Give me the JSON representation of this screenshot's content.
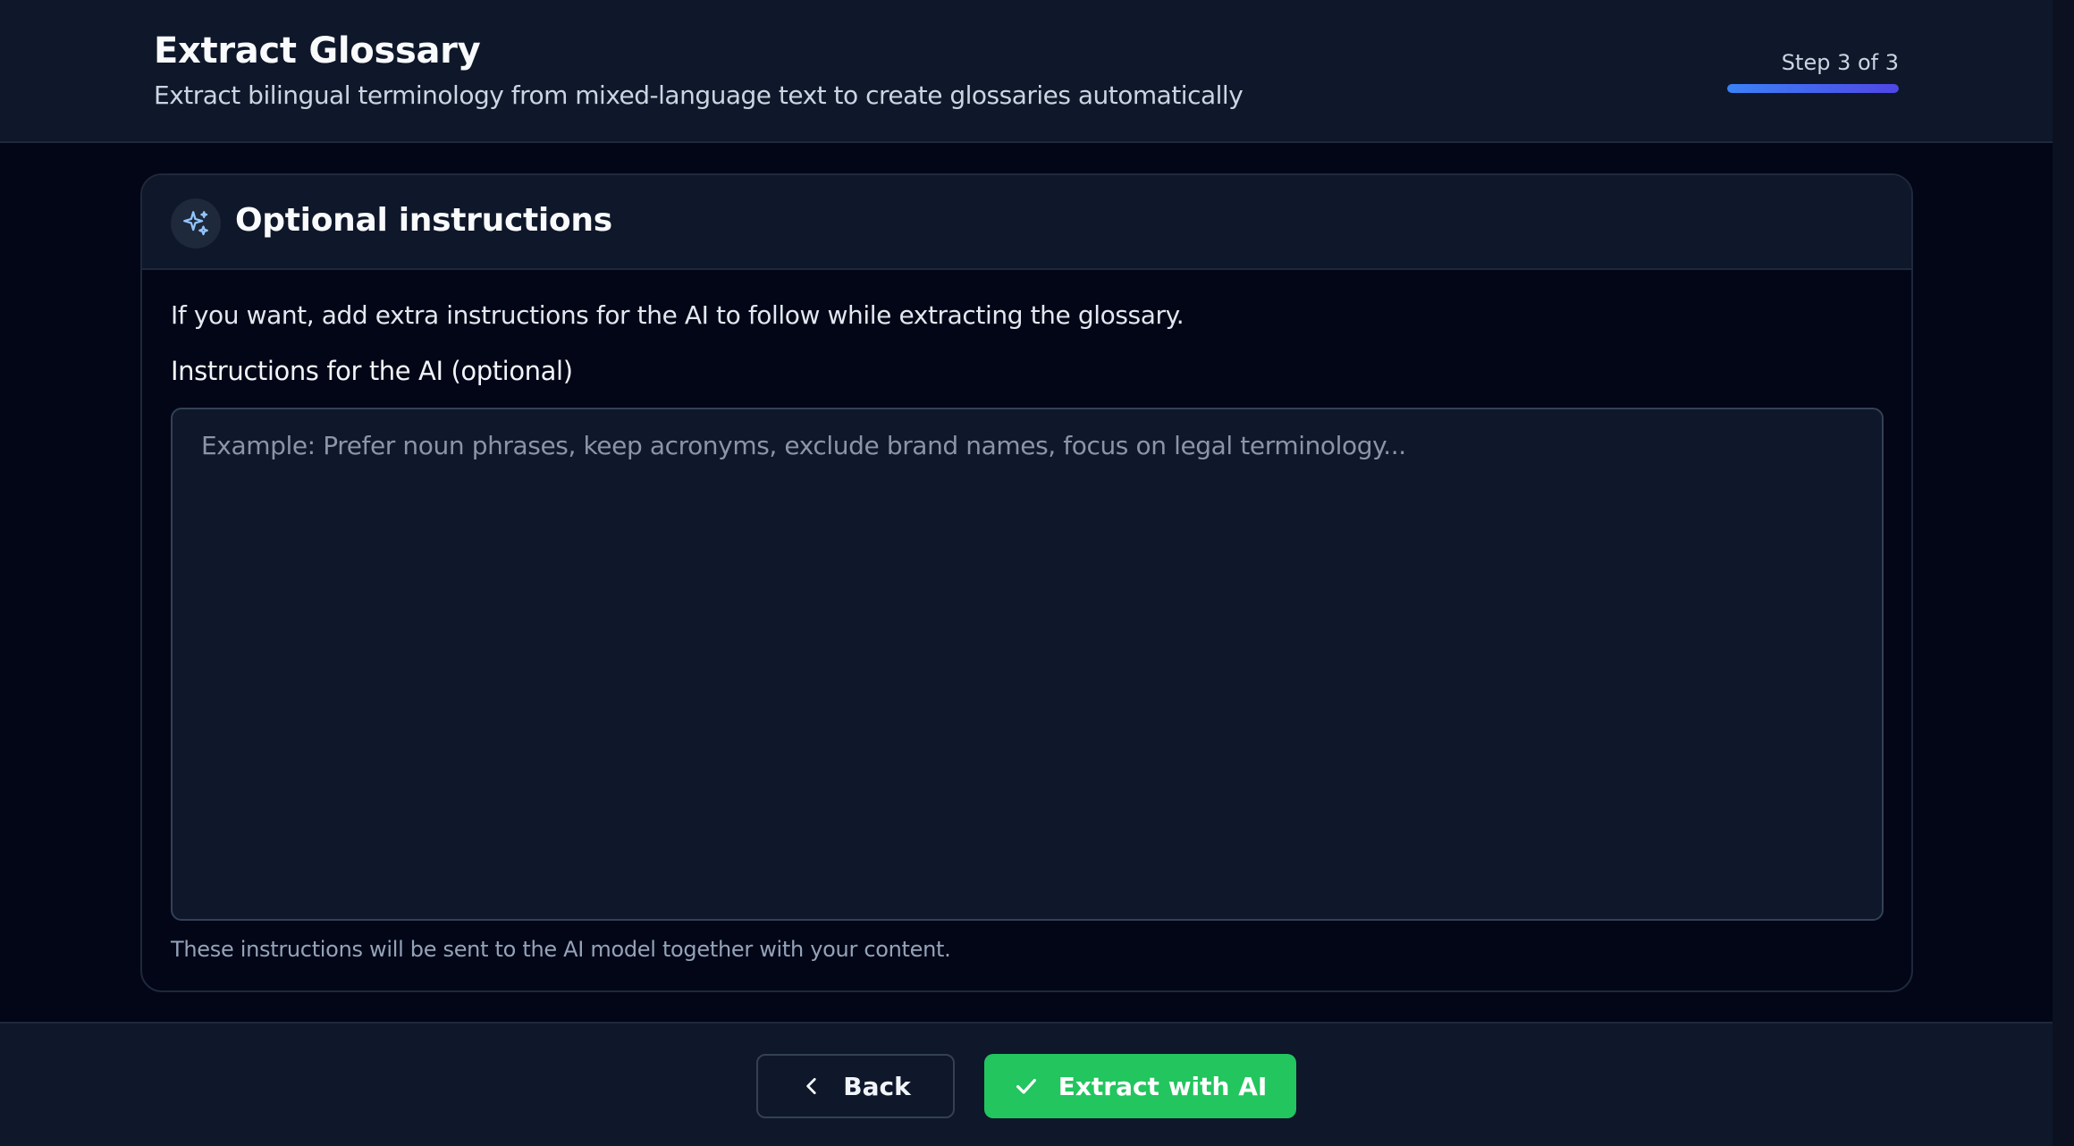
{
  "header": {
    "title": "Extract Glossary",
    "subtitle": "Extract bilingual terminology from mixed-language text to create glossaries automatically",
    "step_label": "Step 3 of 3",
    "progress": 1.0
  },
  "card": {
    "icon": "sparkles-icon",
    "title": "Optional instructions",
    "description": "If you want, add extra instructions for the AI to follow while extracting the glossary.",
    "field_label": "Instructions for the AI (optional)",
    "textarea_value": "",
    "textarea_placeholder": "Example: Prefer noun phrases, keep acronyms, exclude brand names, focus on legal terminology...",
    "helper_text": "These instructions will be sent to the AI model together with your content."
  },
  "footer": {
    "back_label": "Back",
    "back_icon": "chevron-left-icon",
    "extract_label": "Extract with AI",
    "extract_icon": "check-icon"
  },
  "colors": {
    "accent_green": "#22c55e",
    "accent_blue": "#3b82f6",
    "accent_indigo": "#4f46e5",
    "sparkle": "#93c5fd"
  }
}
